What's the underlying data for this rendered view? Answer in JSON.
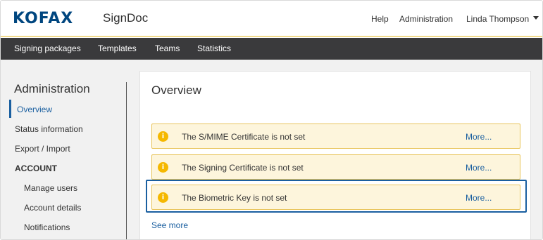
{
  "header": {
    "logo": "KOFAX",
    "product": "SignDoc",
    "links": {
      "help": "Help",
      "administration": "Administration",
      "user": "Linda Thompson"
    }
  },
  "navbar": {
    "items": [
      "Signing packages",
      "Templates",
      "Teams",
      "Statistics"
    ]
  },
  "sidebar": {
    "title": "Administration",
    "items": [
      "Overview",
      "Status information",
      "Export / Import"
    ],
    "section": "ACCOUNT",
    "account_items": [
      "Manage users",
      "Account details",
      "Notifications"
    ],
    "active": "Overview"
  },
  "main": {
    "title": "Overview",
    "alerts": [
      {
        "icon": "info-icon",
        "text": "The S/MIME Certificate is not set",
        "link": "More..."
      },
      {
        "icon": "info-icon",
        "text": "The Signing Certificate is not set",
        "link": "More..."
      },
      {
        "icon": "info-icon",
        "text": "The Biometric Key is not set",
        "link": "More..."
      }
    ],
    "see_more": "See more"
  },
  "colors": {
    "accent": "#1a5fa0",
    "navbar": "#3a3a3c",
    "warning_bg": "#fdf5dc",
    "warning_border": "#e8c45a",
    "warning_icon": "#f5b800"
  }
}
